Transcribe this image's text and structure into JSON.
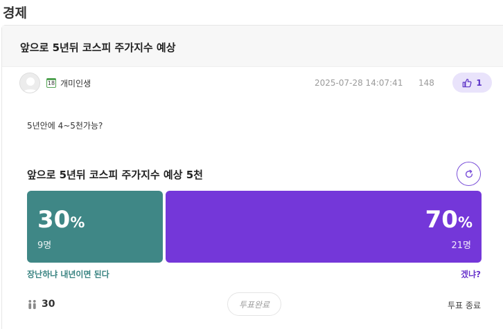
{
  "board": {
    "category": "경제"
  },
  "post": {
    "title": "앞으로 5년뒤 코스피 주가지수 예상",
    "author": {
      "level": "18",
      "nickname": "개미인생"
    },
    "datetime": "2025-07-28 14:07:41",
    "views": "148",
    "likes": "1",
    "body": "5년안에 4~5천가능?"
  },
  "poll": {
    "title": "앞으로 5년뒤 코스피 주가지수 예상 5천",
    "options": [
      {
        "percent": "30",
        "unit": "%",
        "count": "9명",
        "label": "장난하냐 내년이면 된다",
        "share": 0.3,
        "color": "#3f8786"
      },
      {
        "percent": "70",
        "unit": "%",
        "count": "21명",
        "label": "겠냐?",
        "share": 0.7,
        "color": "#7437d9"
      }
    ],
    "total_voters": "30",
    "status_button": "투표완료",
    "end_label": "투표 종료"
  },
  "icons": {
    "avatar": "user-silhouette-icon",
    "level": "level-badge-icon",
    "like": "thumbs-up-icon",
    "refresh": "refresh-icon",
    "voters": "people-icon"
  }
}
